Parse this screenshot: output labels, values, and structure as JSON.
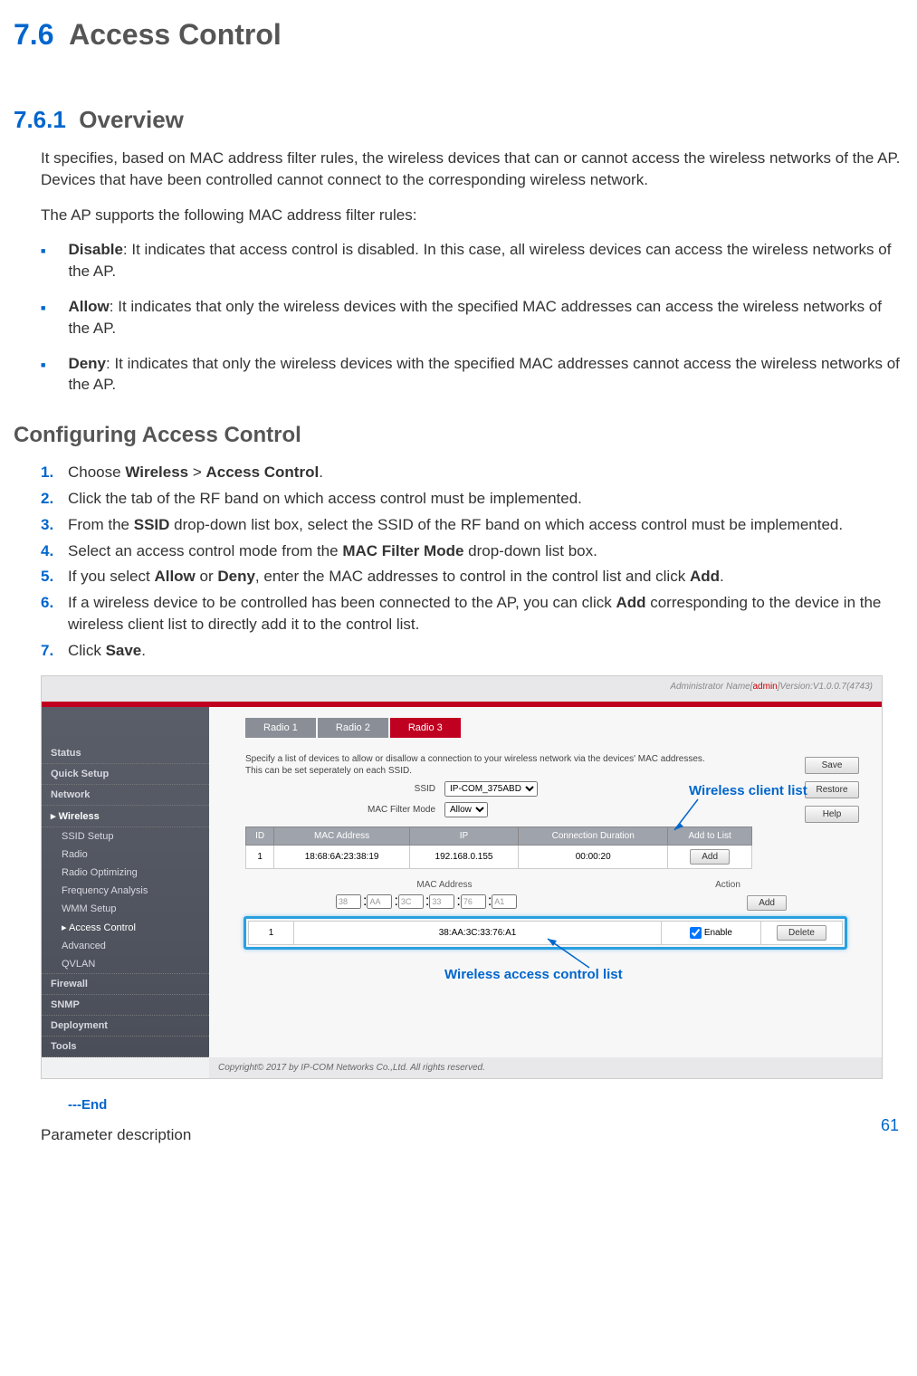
{
  "section": {
    "num": "7.6",
    "title": "Access Control"
  },
  "overview": {
    "num": "7.6.1",
    "title": "Overview",
    "p1": "It specifies, based on MAC address filter rules, the wireless devices that can or cannot access the wireless networks of the AP. Devices that have been controlled cannot connect to the corresponding wireless network.",
    "p2": "The AP supports the following MAC address filter rules:",
    "bullets": [
      {
        "term": "Disable",
        "text": ": It indicates that access control is disabled. In this case, all wireless devices can access the wireless networks of the AP."
      },
      {
        "term": "Allow",
        "text": ": It indicates that only the wireless devices with the specified MAC addresses can access the wireless networks of the AP."
      },
      {
        "term": "Deny",
        "text": ": It indicates that only the wireless devices with the specified MAC addresses cannot access the wireless networks of the AP."
      }
    ]
  },
  "config": {
    "title": "Configuring Access Control",
    "steps": [
      {
        "n": "1.",
        "pre": "Choose ",
        "b1": "Wireless",
        "mid": " > ",
        "b2": "Access Control",
        "post": "."
      },
      {
        "n": "2.",
        "text": "Click the tab of the RF band on which access control must be implemented."
      },
      {
        "n": "3.",
        "pre": "From the ",
        "b1": "SSID",
        "post": " drop-down list box, select the SSID of the RF band on which access control must be implemented."
      },
      {
        "n": "4.",
        "pre": "Select an access control mode from the ",
        "b1": "MAC Filter Mode",
        "post": " drop-down list box."
      },
      {
        "n": "5.",
        "pre": "If you select ",
        "b1": "Allow",
        "mid": " or ",
        "b2": "Deny",
        "post2": ", enter the MAC addresses to control in the control list and click ",
        "b3": "Add",
        "post3": "."
      },
      {
        "n": "6.",
        "pre": "If a wireless device to be controlled has been connected to the AP, you can click ",
        "b1": "Add",
        "post": " corresponding to the device in the wireless client list to directly add it to the control list."
      },
      {
        "n": "7.",
        "pre": "Click ",
        "b1": "Save",
        "post": "."
      }
    ]
  },
  "ss": {
    "topbar_pre": "Administrator Name[",
    "topbar_admin": "admin",
    "topbar_post": "]Version:V1.0.0.7(4743)",
    "nav": [
      "Status",
      "Quick Setup",
      "Network",
      "Wireless",
      "SSID Setup",
      "Radio",
      "Radio Optimizing",
      "Frequency Analysis",
      "WMM Setup",
      "Access Control",
      "Advanced",
      "QVLAN",
      "Firewall",
      "SNMP",
      "Deployment",
      "Tools"
    ],
    "tabs": [
      "Radio 1",
      "Radio 2",
      "Radio 3"
    ],
    "desc1": "Specify a list of devices to allow or disallow a connection to your wireless network via the devices' MAC addresses.",
    "desc2": "This can be set seperately on each SSID.",
    "ssid_label": "SSID",
    "ssid_value": "IP-COM_375ABD",
    "mode_label": "MAC Filter Mode",
    "mode_value": "Allow",
    "client_headers": [
      "ID",
      "MAC Address",
      "IP",
      "Connection Duration",
      "Add to List"
    ],
    "client_row": {
      "id": "1",
      "mac": "18:68:6A:23:38:19",
      "ip": "192.168.0.155",
      "dur": "00:00:20",
      "btn": "Add"
    },
    "mac_header": "MAC Address",
    "action_header": "Action",
    "mac_inputs": [
      "38",
      "AA",
      "3C",
      "33",
      "76",
      "A1"
    ],
    "add_btn": "Add",
    "ctrl_row": {
      "id": "1",
      "mac": "38:AA:3C:33:76:A1",
      "enable": "Enable",
      "btn": "Delete"
    },
    "right_btns": [
      "Save",
      "Restore",
      "Help"
    ],
    "callout1": "Wireless client list",
    "callout2": "Wireless access control list",
    "copyright": "Copyright© 2017 by IP-COM Networks Co.,Ltd. All rights reserved."
  },
  "end": "---End",
  "paramdesc": "Parameter description",
  "pagenum": "61"
}
